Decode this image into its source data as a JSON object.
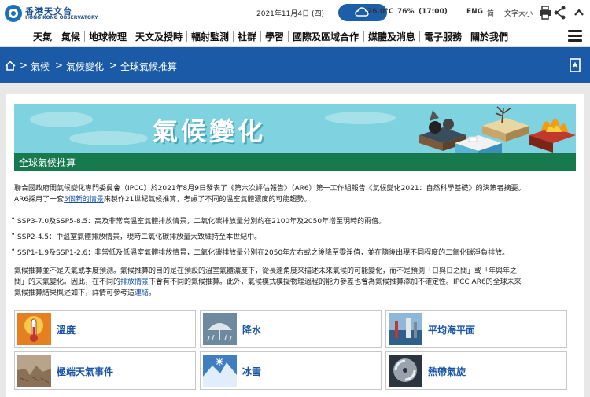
{
  "header": {
    "logo_zh": "香港天文台",
    "logo_en": "HONG KONG OBSERVATORY",
    "date": "2021年11月4日 (四)",
    "temperature": "26.0°C",
    "humidity": "76%",
    "time": "(17:00)",
    "lang_en": "ENG",
    "lang_zh": "简",
    "font_size": "文字大小"
  },
  "nav": {
    "items": [
      "天氣",
      "氣候",
      "地球物理",
      "天文及授時",
      "輻射監測",
      "社群",
      "學習",
      "國際及區域合作",
      "媒體及消息",
      "電子服務",
      "關於我們"
    ]
  },
  "breadcrumb": {
    "items": [
      "氣候",
      "氣候變化",
      "全球氣候推算"
    ]
  },
  "banner": {
    "title": "氣候變化",
    "subtitle": "全球氣候推算"
  },
  "intro": {
    "line1": "聯合國政府間氣候變化專門委員會（IPCC）於2021年8月9日發表了《第六次評估報告》（AR6）第一工作組報告《氣候變化2021：自然科學基礎》的決策者摘要。",
    "line2_pre": "AR6採用了一套",
    "line2_link": "5個新的情景",
    "line2_post": "來製作21世紀氣候推算，考慮了不同的溫室氣體濃度的可能趨勢。"
  },
  "scenarios": [
    "SSP3-7.0及SSP5-8.5：高及非常高溫室氣體排放情景，二氧化碳排放量分別約在2100年及2050年增至現時的兩倍。",
    "SSP2-4.5：中溫室氣體排放情景，現時二氧化碳排放量大致維持至本世紀中。",
    "SSP1-1.9及SSP1-2.6：非常低及低溫室氣體排放情景，二氧化碳排放量分別在2050年左右或之後降至零淨值，並在隨後出現不同程度的二氧化碳淨負排放。"
  ],
  "note": {
    "line1": "氣候推算並不是天氣或季度預測。氣候推算的目的是在預設的溫室氣體濃度下，從長遠角度來描述未來氣候的可能變化，而不是預測「日與日之間」或「年與年之",
    "line2_pre": "間」的天氣變化。因此，在不同的",
    "line2_link": "排放情景",
    "line2_post": "下會有不同的氣候推算。此外，氣候模式模擬物理過程的能力參差也會為氣候推算添加不確定性。IPCC AR6的全球未來",
    "line3_pre": "氣候推算結果概述如下，詳情可參考這",
    "line3_link": "連結",
    "line3_post": "。"
  },
  "tiles": [
    {
      "label": "溫度",
      "icon": "temperature-icon"
    },
    {
      "label": "降水",
      "icon": "rainfall-icon"
    },
    {
      "label": "平均海平面",
      "icon": "sea-level-icon"
    },
    {
      "label": "極端天氣事件",
      "icon": "extreme-weather-icon"
    },
    {
      "label": "冰雪",
      "icon": "snow-ice-icon"
    },
    {
      "label": "熱帶氣旋",
      "icon": "tropical-cyclone-icon"
    }
  ],
  "colors": {
    "brand_blue": "#1a5aa6",
    "banner_green": "#167a4e",
    "banner_cyan": "#7fd2e0",
    "link": "#1a55a6"
  }
}
